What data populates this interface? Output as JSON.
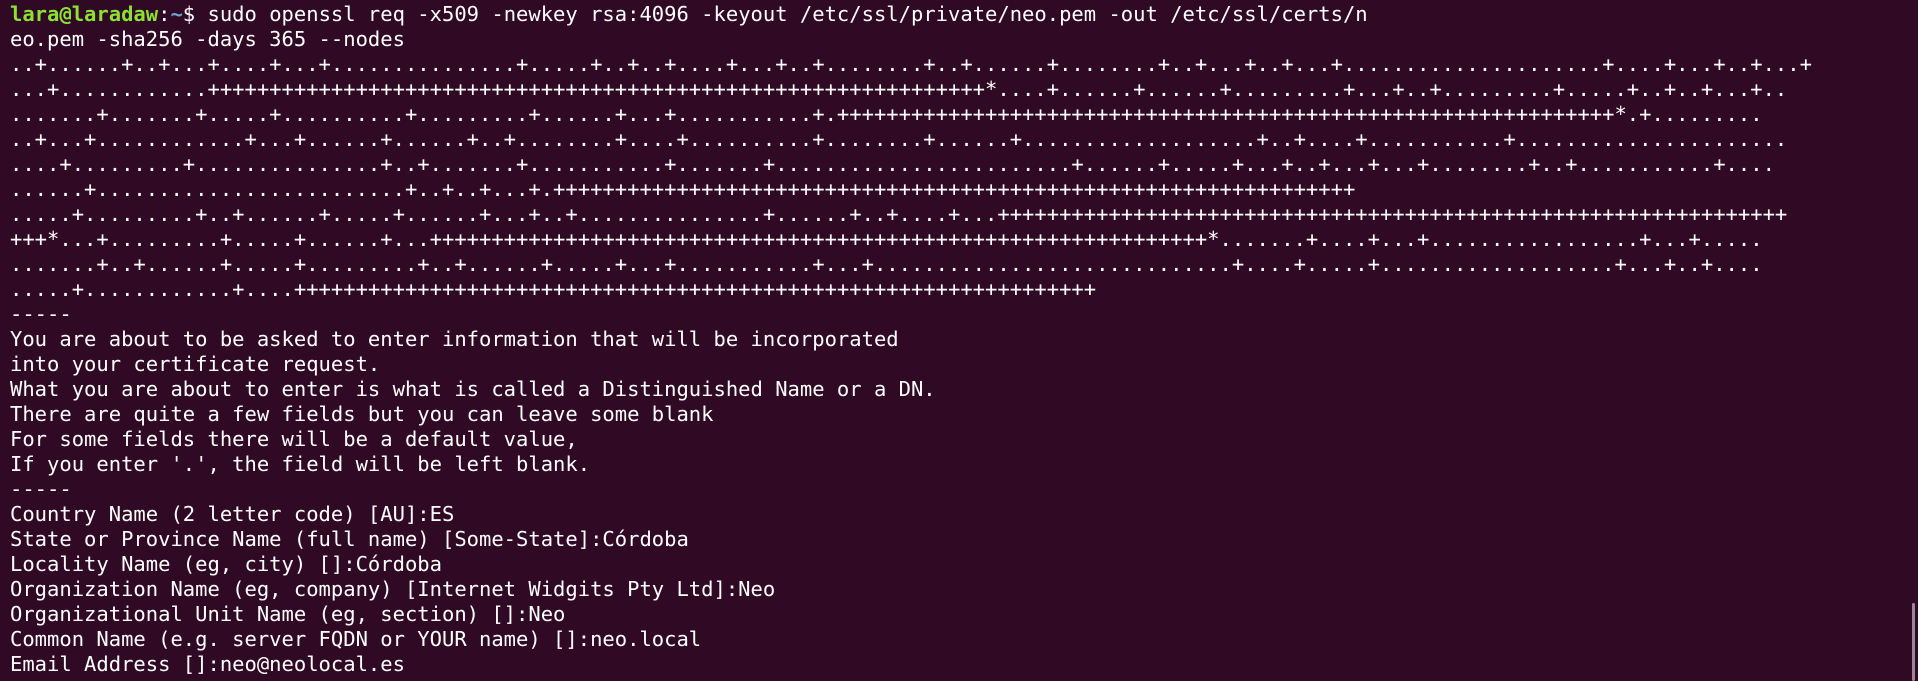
{
  "prompt": {
    "user_host": "lara@laradaw",
    "separator": ":",
    "cwd": "~",
    "symbol": "$ ",
    "command_line1": "sudo openssl req -x509 -newkey rsa:4096 -keyout /etc/ssl/private/neo.pem -out /etc/ssl/certs/n",
    "command_line2": "eo.pem -sha256 -days 365 --nodes"
  },
  "keygen_output": [
    "..+......+..+...+....+...+...............+.....+..+..+....+...+..+........+..+......+........+..+...+..+...+.....................+....+...+..+...+",
    "...+............+++++++++++++++++++++++++++++++++++++++++++++++++++++++++++++++*....+......+......+.........+...+..+.........+.....+..+..+...+..",
    ".......+.......+.....+..........+.........+......+...+...........+.+++++++++++++++++++++++++++++++++++++++++++++++++++++++++++++++*.+.........",
    "..+...+............+...+......+......+..+........+....+..........+........+......+...................+..+....+...........+......................",
    "....+.........+...............+..+.......+...........+.......+........................+......+.....+...+..+...+...+........+..+...........+....",
    "......+.........................+..+..+...+.+++++++++++++++++++++++++++++++++++++++++++++++++++++++++++++++++",
    ".....+.........+..+......+.....+......+...+..+...............+......+..+....+...++++++++++++++++++++++++++++++++++++++++++++++++++++++++++++++++",
    "+++*...+.........+.....+......+...+++++++++++++++++++++++++++++++++++++++++++++++++++++++++++++++*.......+....+...+.................+...+.....",
    ".......+..+......+.....+.........+..+......+.....+...+...........+...+.............................+....+.....+...................+...+..+....",
    ".....+............+....+++++++++++++++++++++++++++++++++++++++++++++++++++++++++++++++++"
  ],
  "separator_dashes": "-----",
  "info_lines": [
    "You are about to be asked to enter information that will be incorporated",
    "into your certificate request.",
    "What you are about to enter is what is called a Distinguished Name or a DN.",
    "There are quite a few fields but you can leave some blank",
    "For some fields there will be a default value,",
    "If you enter '.', the field will be left blank."
  ],
  "dn_prompts": [
    "Country Name (2 letter code) [AU]:ES",
    "State or Province Name (full name) [Some-State]:Córdoba",
    "Locality Name (eg, city) []:Córdoba",
    "Organization Name (eg, company) [Internet Widgits Pty Ltd]:Neo",
    "Organizational Unit Name (eg, section) []:Neo",
    "Common Name (e.g. server FQDN or YOUR name) []:neo.local",
    "Email Address []:neo@neolocal.es"
  ],
  "theme": {
    "background": "#300a24",
    "foreground": "#ffffff",
    "user_color": "#8ae234",
    "path_color": "#729fcf"
  }
}
